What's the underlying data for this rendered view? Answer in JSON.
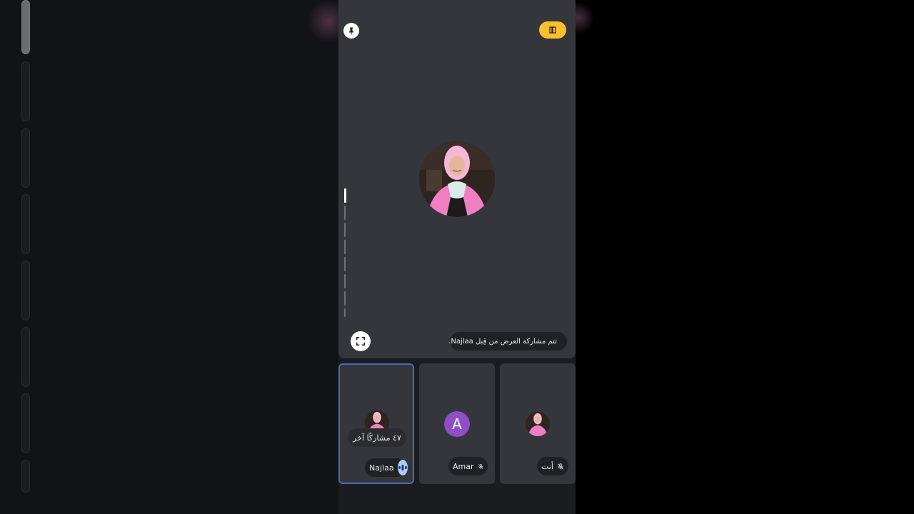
{
  "stage": {
    "share_text": "تتم مشاركة العرض من قِبل Najlaa.",
    "pin_icon": "pin-icon",
    "present_icon": "present-icon",
    "fullscreen_icon": "fullscreen-icon",
    "muted_icon": "mic-off-icon",
    "audio_level": 0.1
  },
  "tiles": [
    {
      "name": "Najlaa",
      "overlay": "٤٧ مشاركًا آخر",
      "status_icon": "speaking-icon"
    },
    {
      "name": "Amar",
      "avatar_letter": "A",
      "status_icon": "mic-off-icon"
    },
    {
      "name": "أنت",
      "status_icon": "mic-off-icon"
    }
  ],
  "colors": {
    "stage_bg": "#34363b",
    "present_accent": "#fbc02d",
    "active_border": "#4a6ab8",
    "avatar_letter_bg": "#8e4ec6",
    "speaking_bg": "#aecbfa"
  }
}
